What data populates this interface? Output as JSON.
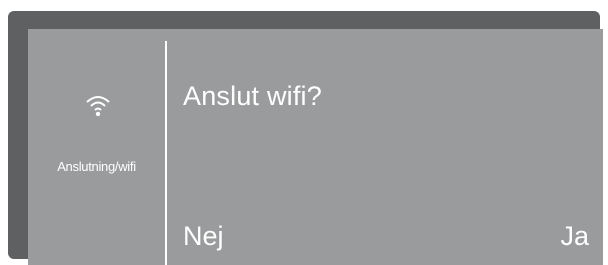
{
  "side_panel": {
    "icon": "wifi-icon",
    "label": "Anslutning/wifi"
  },
  "dialog": {
    "question": "Anslut wifi?",
    "no_label": "Nej",
    "yes_label": "Ja"
  },
  "colors": {
    "bezel": "#5f6062",
    "screen": "#9a9b9c",
    "text": "#ffffff"
  }
}
